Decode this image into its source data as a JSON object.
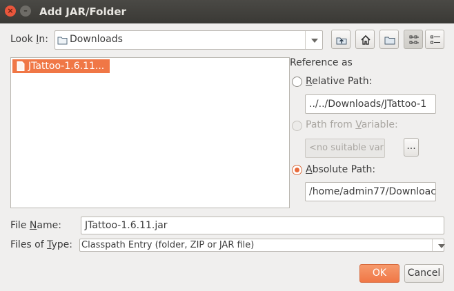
{
  "window": {
    "title": "Add JAR/Folder",
    "close_glyph": "×",
    "minimize_glyph": "–"
  },
  "look_in": {
    "label_pre": "Look ",
    "label_mnemonic": "I",
    "label_post": "n:",
    "value": "Downloads"
  },
  "toolbar": {
    "buttons": [
      {
        "name": "up-one-level-icon"
      },
      {
        "name": "home-icon"
      },
      {
        "name": "new-folder-icon"
      },
      {
        "name": "list-view-icon",
        "active": true
      },
      {
        "name": "details-view-icon"
      }
    ]
  },
  "file_list": {
    "items": [
      {
        "name": "JTattoo-1.6.11...",
        "selected": true
      }
    ]
  },
  "reference": {
    "heading": "Reference as",
    "relative": {
      "label_mnemonic": "R",
      "label_rest": "elative Path:",
      "value": "../../Downloads/JTattoo-1"
    },
    "variable": {
      "label_pre": "Path from ",
      "label_mnemonic": "V",
      "label_post": "ariable:",
      "value": "<no suitable var",
      "browse_label": "..."
    },
    "absolute": {
      "label_mnemonic": "A",
      "label_rest": "bsolute Path:",
      "value": "/home/admin77/Downloac"
    }
  },
  "file_name": {
    "label_pre": "File ",
    "label_mnemonic": "N",
    "label_post": "ame:",
    "value": "JTattoo-1.6.11.jar"
  },
  "file_type": {
    "label_pre": "Files of ",
    "label_mnemonic": "T",
    "label_post": "ype:",
    "value": "Classpath Entry (folder, ZIP or JAR file)"
  },
  "buttons": {
    "ok": "OK",
    "cancel": "Cancel"
  },
  "colors": {
    "accent": "#f07746",
    "titlebar": "#3f3e3a",
    "close": "#e9563c"
  }
}
